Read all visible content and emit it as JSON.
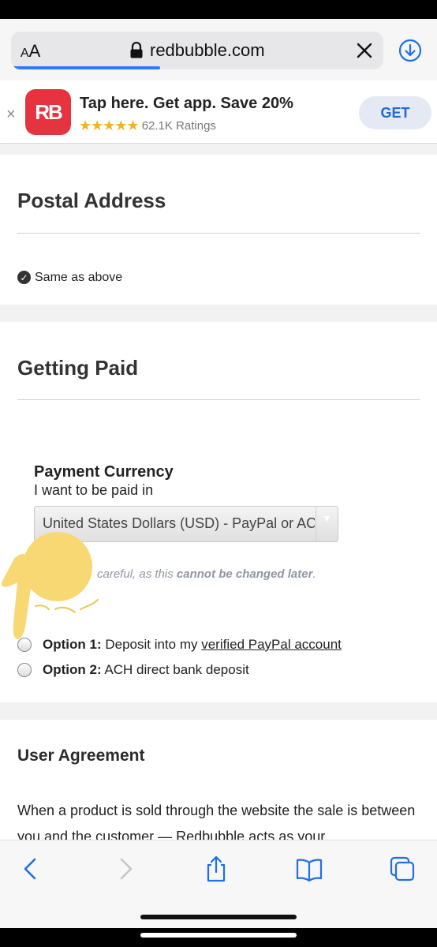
{
  "browser": {
    "aa_big": "A",
    "aa_small": "A",
    "url": "redbubble.com",
    "load_progress": 0.4
  },
  "app_banner": {
    "logo_text": "RB",
    "title": "Tap here. Get app. Save 20%",
    "stars": "★★★★★",
    "ratings": "62.1K Ratings",
    "get_label": "GET",
    "close_symbol": "×"
  },
  "postal": {
    "title": "Postal Address",
    "same_as_above_label": "Same as above",
    "same_as_above_checked": true
  },
  "getting_paid": {
    "title": "Getting Paid",
    "currency_heading": "Payment Currency",
    "currency_subtext": "I want to be paid in",
    "currency_selected": "United States Dollars (USD) - PayPal or ACH",
    "warning_prefix": "careful, as this ",
    "warning_bold": "cannot be changed later",
    "warning_suffix": ".",
    "option1_bold": "Option 1:",
    "option1_text": " Deposit into my ",
    "option1_link": "verified PayPal account",
    "option2_bold": "Option 2:",
    "option2_text": " ACH direct bank deposit"
  },
  "agreement": {
    "title": "User Agreement",
    "text": "When a product is sold through the website the sale is between you and the customer — Redbubble acts as your"
  },
  "colors": {
    "accent": "#2c7cf6",
    "brand": "#e5333f",
    "star": "#f3b02a",
    "pointer": "#f8d872"
  },
  "icons": [
    "lock-icon",
    "clear-icon",
    "download-icon",
    "back-icon",
    "forward-icon",
    "share-icon",
    "bookmarks-icon",
    "tabs-icon",
    "pointing-hand-icon"
  ]
}
